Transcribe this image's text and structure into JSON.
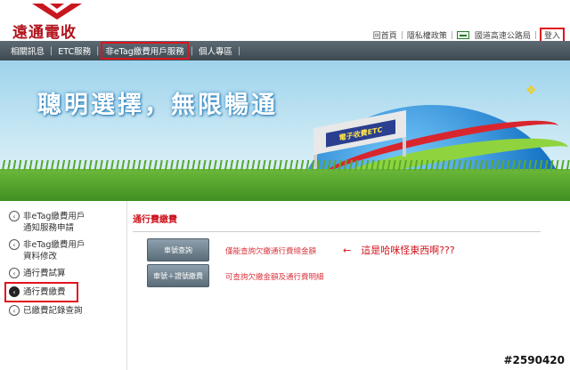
{
  "header": {
    "logo_text": "遠通電收",
    "links": [
      "回首頁",
      "隱私權政策",
      "國道高速公路局"
    ],
    "login": "登入"
  },
  "nav": {
    "items": [
      "相關訊息",
      "ETC服務",
      "非eTag繳費用戶服務",
      "個人專區"
    ]
  },
  "banner": {
    "slogan": "聰明選擇，無限暢通",
    "sign_text": "電子收費ETC"
  },
  "sidebar": {
    "items": [
      {
        "label_line1": "非eTag繳費用戶",
        "label_line2": "通知服務申請"
      },
      {
        "label_line1": "非eTag繳費用戶",
        "label_line2": "資料修改"
      },
      {
        "label_line1": "通行費試算",
        "label_line2": ""
      },
      {
        "label_line1": "通行費繳費",
        "label_line2": ""
      },
      {
        "label_line1": "已繳費記錄查詢",
        "label_line2": ""
      }
    ]
  },
  "main": {
    "title": "通行費繳費",
    "buttons": [
      {
        "label": "車號查詢",
        "desc": "僅能查詢欠繳通行費總金額"
      },
      {
        "label": "車號＋證號繳費",
        "desc": "可查詢欠繳金額及通行費明細"
      }
    ],
    "annotation": "←　這是哈咪怪東西啊???"
  },
  "watermark": "#2590420",
  "colors": {
    "accent_red": "#e0141e",
    "nav_bg": "#4a565e",
    "button_bg": "#6e7f8c"
  }
}
